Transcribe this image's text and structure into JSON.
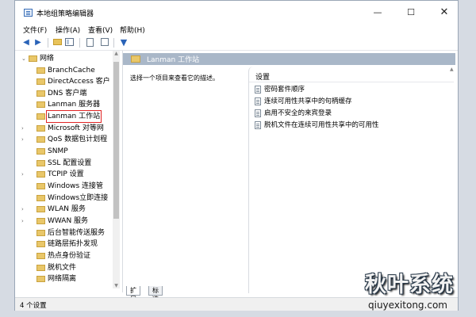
{
  "window": {
    "title": "本地组策略编辑器",
    "minimize_glyph": "—",
    "maximize_glyph": "☐",
    "close_glyph": "✕"
  },
  "menu": [
    "文件(F)",
    "操作(A)",
    "查看(V)",
    "帮助(H)"
  ],
  "toolbar": {
    "back_icon": "back-arrow-icon",
    "forward_icon": "forward-arrow-icon",
    "filter_icon": "filter-icon"
  },
  "tree": {
    "items": [
      {
        "label": "网络",
        "expandable": true,
        "expanded": true,
        "level": 0
      },
      {
        "label": "BranchCache",
        "expandable": false,
        "level": 1
      },
      {
        "label": "DirectAccess 客户",
        "expandable": false,
        "level": 1
      },
      {
        "label": "DNS 客户端",
        "expandable": false,
        "level": 1
      },
      {
        "label": "Lanman 服务器",
        "expandable": false,
        "level": 1
      },
      {
        "label": "Lanman 工作站",
        "expandable": false,
        "level": 1,
        "selected": true
      },
      {
        "label": "Microsoft 对等网",
        "expandable": true,
        "level": 1
      },
      {
        "label": "QoS 数据包计划程",
        "expandable": true,
        "level": 1
      },
      {
        "label": "SNMP",
        "expandable": false,
        "level": 1
      },
      {
        "label": "SSL 配置设置",
        "expandable": false,
        "level": 1
      },
      {
        "label": "TCPIP 设置",
        "expandable": true,
        "level": 1
      },
      {
        "label": "Windows 连接管",
        "expandable": false,
        "level": 1
      },
      {
        "label": "Windows立即连接",
        "expandable": false,
        "level": 1
      },
      {
        "label": "WLAN 服务",
        "expandable": true,
        "level": 1
      },
      {
        "label": "WWAN 服务",
        "expandable": true,
        "level": 1
      },
      {
        "label": "后台智能传送服务",
        "expandable": false,
        "level": 1
      },
      {
        "label": "链路层拓扑发现",
        "expandable": false,
        "level": 1
      },
      {
        "label": "热点身份验证",
        "expandable": false,
        "level": 1
      },
      {
        "label": "脱机文件",
        "expandable": false,
        "level": 1
      },
      {
        "label": "网络隔离",
        "expandable": false,
        "level": 1
      }
    ]
  },
  "content": {
    "header_title": "Lanman 工作站",
    "description": "选择一个项目来查看它的描述。",
    "settings_header": "设置",
    "settings": [
      "密码套件顺序",
      "连续可用性共享中的句柄缓存",
      "启用不安全的来宾登录",
      "脱机文件在连续可用性共享中的可用性"
    ]
  },
  "tabs": [
    "扩展",
    "标准"
  ],
  "status": "4 个设置",
  "watermark": {
    "text": "秋叶系统",
    "url": "qiuyexitong.com"
  }
}
